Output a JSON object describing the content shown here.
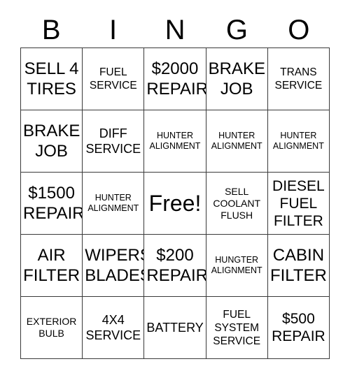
{
  "header": {
    "letters": [
      "B",
      "I",
      "N",
      "G",
      "O"
    ]
  },
  "grid": {
    "rows": 5,
    "columns": 5,
    "border_color": "#3a3a3a",
    "background_color": "#ffffff",
    "text_color": "#000000",
    "cells": [
      {
        "text": "SELL 4\nTIRES",
        "size": "xxl",
        "free": false
      },
      {
        "text": "FUEL\nSERVICE",
        "size": "md",
        "free": false
      },
      {
        "text": "$2000\nREPAIR",
        "size": "xxl",
        "free": false
      },
      {
        "text": "BRAKE\nJOB",
        "size": "xxl",
        "free": false
      },
      {
        "text": "TRANS\nSERVICE",
        "size": "md",
        "free": false
      },
      {
        "text": "BRAKE\nJOB",
        "size": "xxl",
        "free": false
      },
      {
        "text": "DIFF\nSERVICE",
        "size": "lg",
        "free": false
      },
      {
        "text": "HUNTER\nALIGNMENT",
        "size": "xs",
        "free": false
      },
      {
        "text": "HUNTER\nALIGNMENT",
        "size": "xs",
        "free": false
      },
      {
        "text": "HUNTER\nALIGNMENT",
        "size": "xs",
        "free": false
      },
      {
        "text": "$1500\nREPAIR",
        "size": "xxl",
        "free": false
      },
      {
        "text": "HUNTER\nALIGNMENT",
        "size": "xs",
        "free": false
      },
      {
        "text": "Free!",
        "size": "free",
        "free": true
      },
      {
        "text": "SELL\nCOOLANT\nFLUSH",
        "size": "sm",
        "free": false
      },
      {
        "text": "DIESEL\nFUEL\nFILTER",
        "size": "xl",
        "free": false
      },
      {
        "text": "AIR\nFILTER",
        "size": "xxl",
        "free": false
      },
      {
        "text": "WIPERS\nBLADES",
        "size": "xxl",
        "free": false
      },
      {
        "text": "$200\nREPAIR",
        "size": "xxl",
        "free": false
      },
      {
        "text": "HUNGTER\nALIGNMENT",
        "size": "xs",
        "free": false
      },
      {
        "text": "CABIN\nFILTER",
        "size": "xxl",
        "free": false
      },
      {
        "text": "EXTERIOR\nBULB",
        "size": "sm",
        "free": false
      },
      {
        "text": "4X4\nSERVICE",
        "size": "lg",
        "free": false
      },
      {
        "text": "BATTERY",
        "size": "lg",
        "free": false
      },
      {
        "text": "FUEL\nSYSTEM\nSERVICE",
        "size": "md",
        "free": false
      },
      {
        "text": "$500\nREPAIR",
        "size": "xl",
        "free": false
      }
    ]
  }
}
